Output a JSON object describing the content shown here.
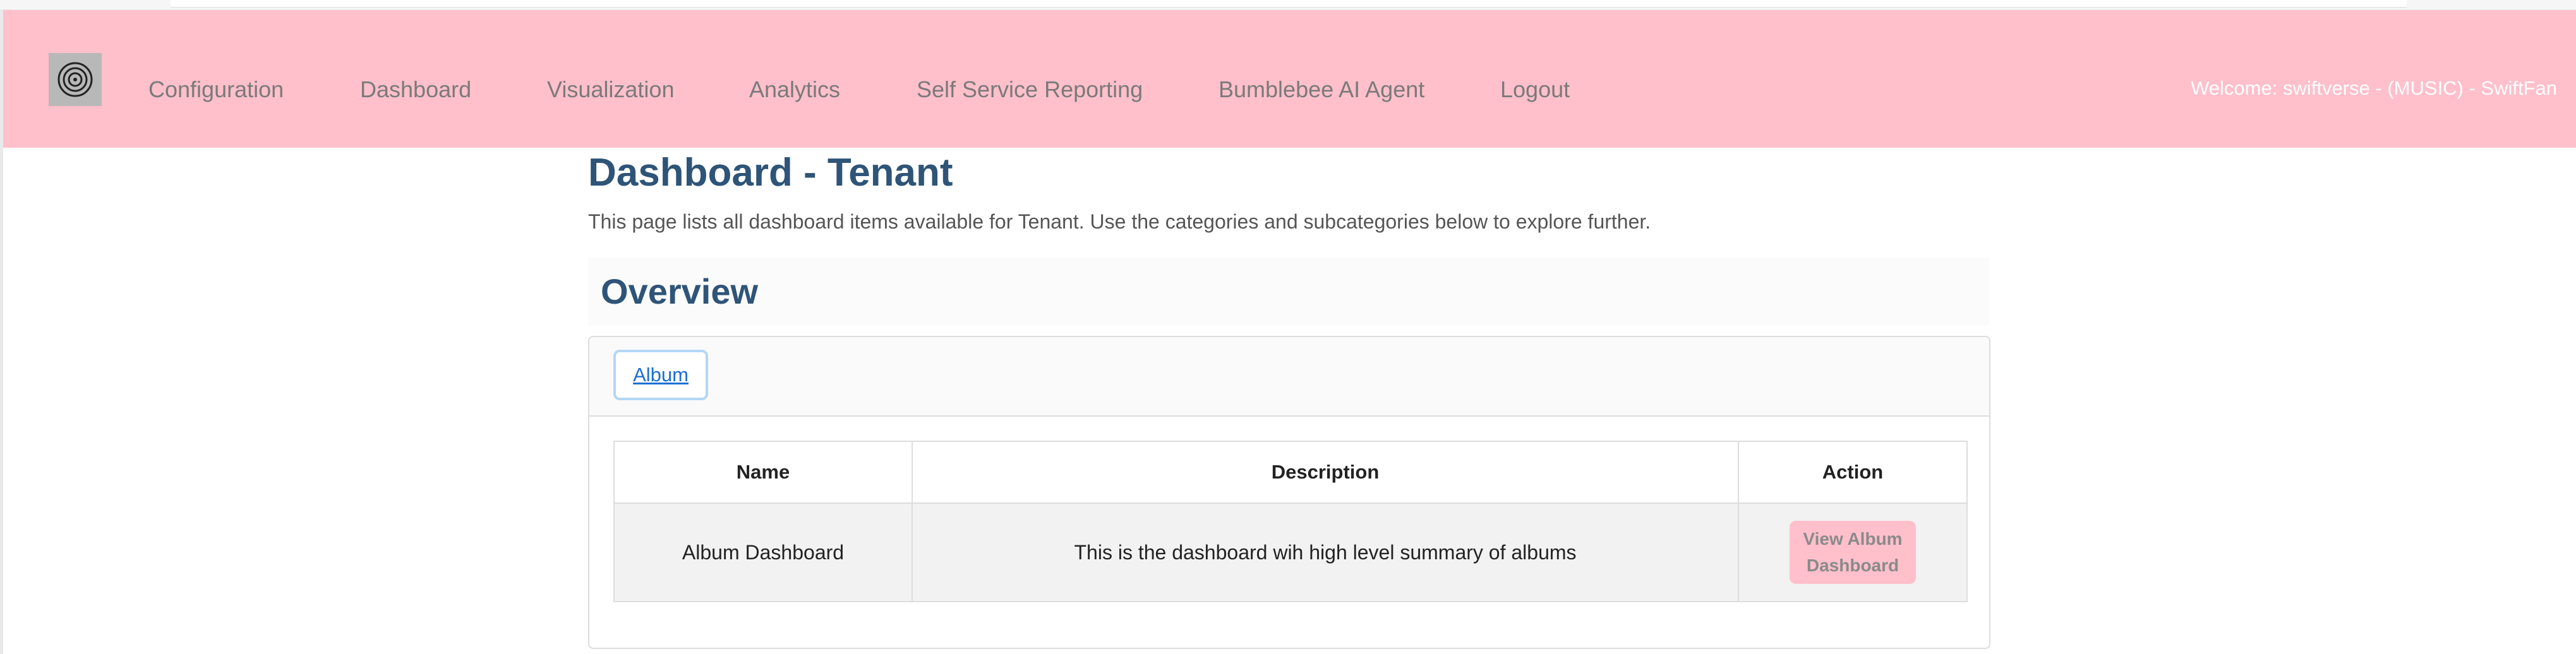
{
  "navbar": {
    "logo_icon": "spiral-logo-icon",
    "links": [
      "Configuration",
      "Dashboard",
      "Visualization",
      "Analytics",
      "Self Service Reporting",
      "Bumblebee AI Agent",
      "Logout"
    ],
    "welcome": "Welcome: swiftverse - (MUSIC) - SwiftFan",
    "background_color": "#ffc0cb"
  },
  "page": {
    "title": "Dashboard - Tenant",
    "intro": "This page lists all dashboard items available for Tenant. Use the categories and subcategories below to explore further.",
    "title_color": "#2e5478"
  },
  "overview": {
    "heading": "Overview",
    "tabs": [
      {
        "label": "Album",
        "active": true
      }
    ],
    "table": {
      "columns": [
        "Name",
        "Description",
        "Action"
      ],
      "rows": [
        {
          "name": "Album Dashboard",
          "description": "This is the dashboard wih high level summary of albums",
          "action_label": "View Album\nDashboard"
        }
      ]
    }
  }
}
